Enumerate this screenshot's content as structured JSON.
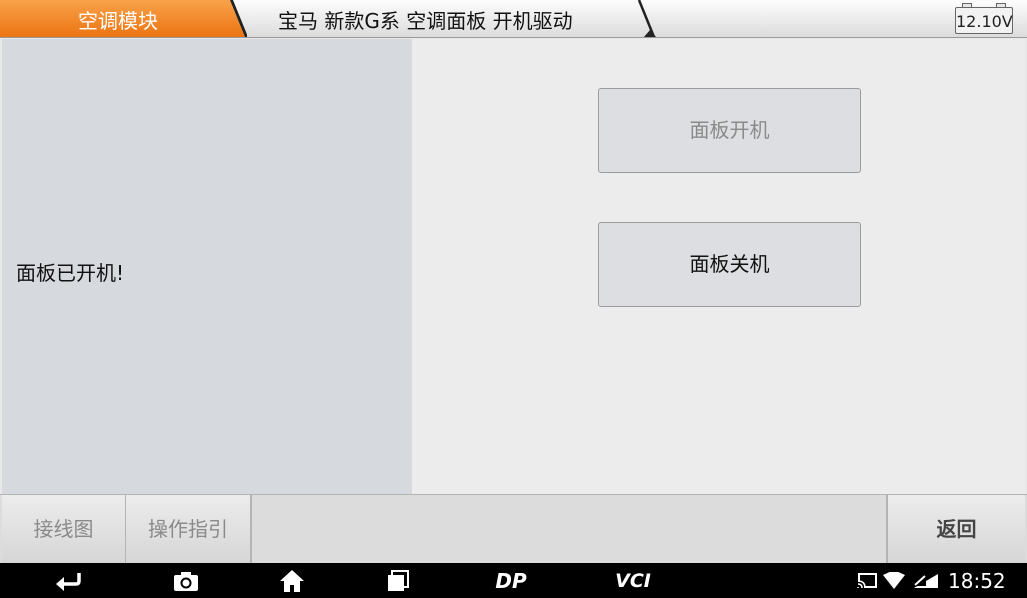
{
  "header": {
    "module_label": "空调模块",
    "path_label": "宝马 新款G系 空调面板 开机驱动",
    "voltage": "12.10V",
    "accent_color": "#f07d1f"
  },
  "left_panel": {
    "status_message": "面板已开机!"
  },
  "actions": {
    "panel_on_label": "面板开机",
    "panel_off_label": "面板关机"
  },
  "bottom_bar": {
    "wiring_label": "接线图",
    "guide_label": "操作指引",
    "back_label": "返回"
  },
  "android_nav": {
    "dp_label": "DP",
    "vci_label": "VCI",
    "time": "18:52",
    "icons": [
      "back-icon",
      "camera-icon",
      "home-icon",
      "recent-apps-icon",
      "cast-icon",
      "wifi-icon",
      "sim-icon"
    ]
  }
}
